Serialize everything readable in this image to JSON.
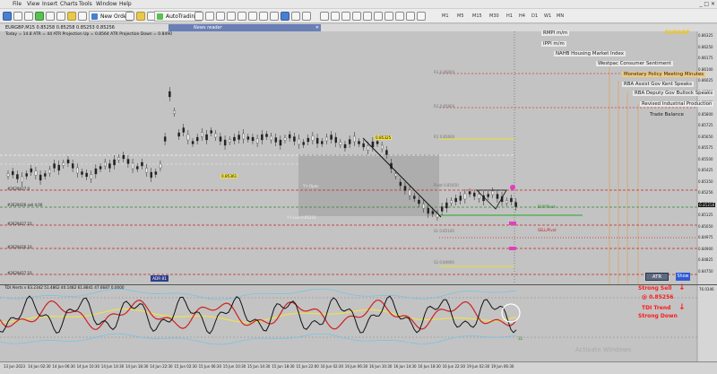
{
  "menu": {
    "items": [
      "File",
      "View",
      "Insert",
      "Charts",
      "Tools",
      "Window",
      "Help"
    ]
  },
  "toolbar": {
    "new_order_label": "New Order",
    "autotrading_label": "AutoTrading",
    "timeframes": [
      "M1",
      "M5",
      "M15",
      "M30",
      "H1",
      "H4",
      "D1",
      "W1",
      "MN"
    ]
  },
  "chart": {
    "symbol_line": "EURGBP,M15  0.85258 0.85258 0.85253 0.85256",
    "info_line": "Today = 14.8      ATR = 44      ATR Projection Up = 0.8564      ATR Projection Down = 0.8490",
    "news_window_title": "News reader",
    "symbol_tag": "EURGBP",
    "price_ticks": [
      "0.86325",
      "0.86250",
      "0.86175",
      "0.86100",
      "0.86025",
      "0.85950",
      "0.85875",
      "0.85800",
      "0.85725",
      "0.85650",
      "0.85575",
      "0.85500",
      "0.85425",
      "0.85350",
      "0.85256",
      "0.85200",
      "0.85125",
      "0.85050",
      "0.84975",
      "0.84900",
      "0.84825",
      "0.84750"
    ],
    "level_labels": [
      "#2629427.0",
      "#2629426 sell 4.00",
      "#2629427.10",
      "#2629426.10",
      "#2629427.10"
    ],
    "pivot_labels": {
      "r3": "R3 0.86000",
      "r2": "R2 0.85800",
      "r1": "R1 0.85600",
      "pivot": "Pivot 0.85450",
      "s1": "S1 0.85100",
      "s2": "S2 0.84900",
      "bp_pivot": "BUY/Pivot",
      "sell_pivot": "SELL/Pivot",
      "y_open": "Y's Open",
      "y_low": "Y's Low  0.85210"
    },
    "chips": {
      "c1": "0.85325",
      "c2": "0.85361",
      "c3": "0.85256"
    }
  },
  "news": {
    "items": [
      "RMPI m/m",
      "IPPI m/m",
      "NAHB Housing Market Index",
      "Westpac Consumer Sentiment",
      "Monetary Policy Meeting Minutes",
      "RBA Assist Gov Kent Speaks",
      "RBA Deputy Gov Bullock Speaks",
      "Revised Industrial Production",
      "Trade Balance"
    ]
  },
  "buttons": {
    "atr": "ATR",
    "show": "Show",
    "adr": "ADR 81"
  },
  "indicator": {
    "title": "TDI Alerts v  63.2342  51.4862  40.1482  61.8841  47.6687  0.0000",
    "levels": [
      "76.0346",
      "32"
    ],
    "sell_title": "Strong Sell",
    "sell_price": "@ 0.85256",
    "trend_title": "TDI Trend",
    "trend_state": "Strong Down"
  },
  "time_axis": {
    "ticks": [
      "13 Jun 2023",
      "14 Jun 02:30",
      "14 Jun 06:30",
      "14 Jun 10:30",
      "14 Jun 14:30",
      "14 Jun 18:30",
      "14 Jun 22:30",
      "15 Jun 02:30",
      "15 Jun 06:30",
      "15 Jun 10:30",
      "15 Jun 14:30",
      "15 Jun 18:30",
      "15 Jun 22:00",
      "16 Jun 02:30",
      "16 Jun 06:30",
      "16 Jun 10:30",
      "16 Jun 14:30",
      "16 Jun 18:30",
      "16 Jun 22:30",
      "19 Jun 02:30",
      "19 Jun 06:30"
    ]
  },
  "watermark": "Activate Windows"
}
